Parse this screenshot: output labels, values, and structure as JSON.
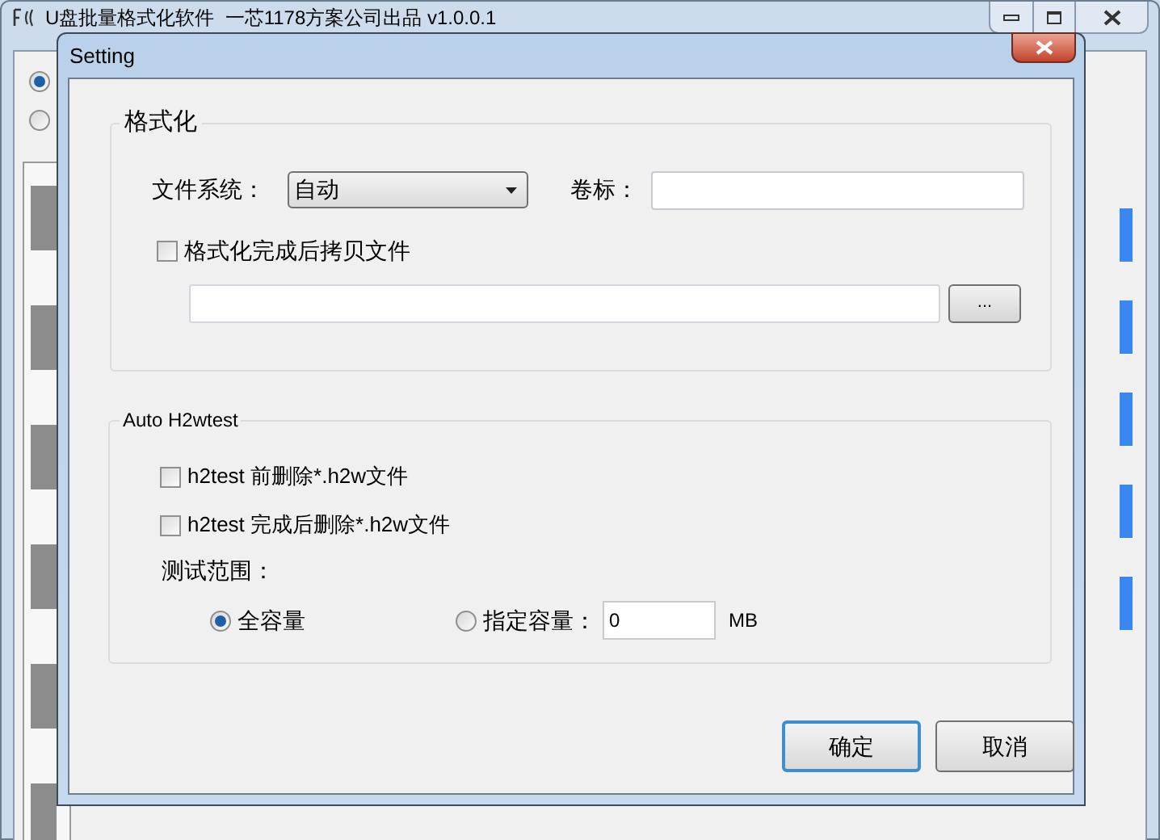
{
  "main_window": {
    "title": "U盘批量格式化软件  一芯1178方案公司出品 v1.0.0.1",
    "mode_radios": [
      {
        "selected": true
      },
      {
        "selected": false
      }
    ]
  },
  "dialog": {
    "title": "Setting",
    "format_group": {
      "title": "格式化",
      "file_system_label": "文件系统：",
      "file_system_value": "自动",
      "volume_label": "卷标：",
      "copy_checkbox": {
        "label": "格式化完成后拷贝文件",
        "checked": false
      },
      "browse_button": "..."
    },
    "h2w_group": {
      "title": "Auto H2wtest",
      "checkboxes": [
        {
          "label": "h2test 前删除*.h2w文件",
          "checked": false
        },
        {
          "label": "h2test 完成后删除*.h2w文件",
          "checked": false
        }
      ],
      "range_label": "测试范围：",
      "range_options": [
        {
          "label": "全容量",
          "selected": true
        },
        {
          "label": "指定容量：",
          "selected": false
        }
      ],
      "capacity_value": "0",
      "unit": "MB"
    },
    "buttons": [
      {
        "label": "确定",
        "default": true
      },
      {
        "label": "取消",
        "default": false
      }
    ]
  }
}
